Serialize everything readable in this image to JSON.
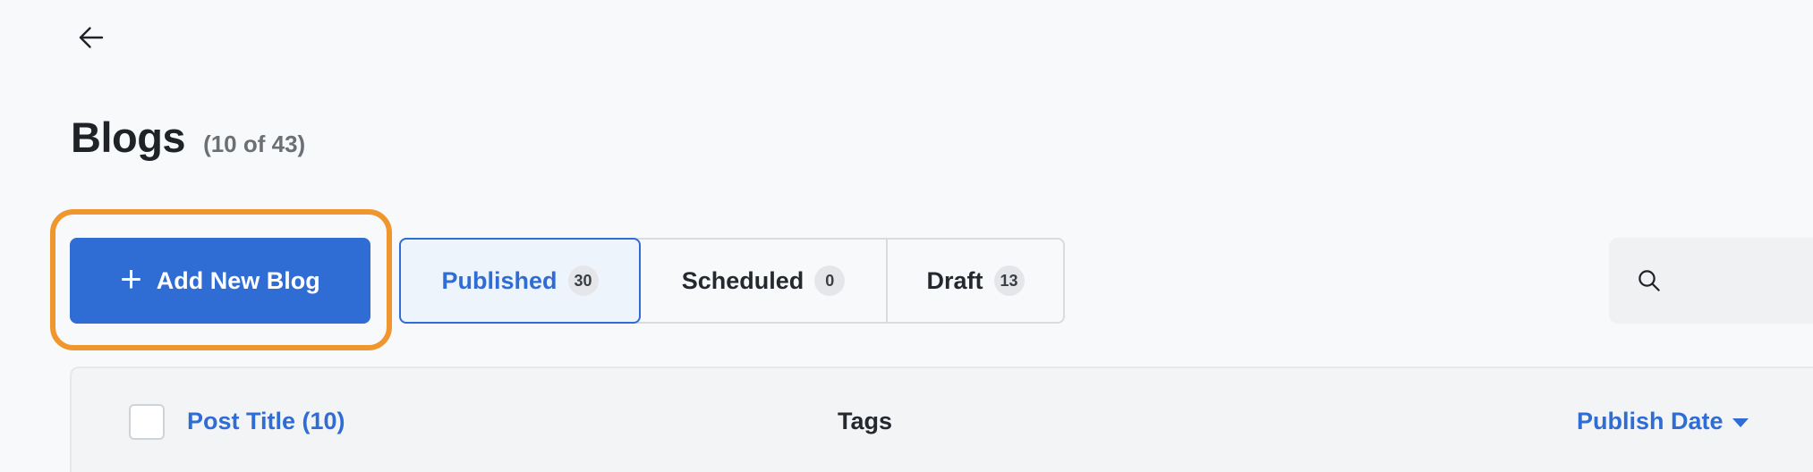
{
  "header": {
    "back_icon": "arrow-left-icon",
    "title": "Blogs",
    "count": "(10 of 43)"
  },
  "toolbar": {
    "add_button_label": "Add New Blog",
    "add_button_icon": "plus-icon",
    "highlight_color": "#f0962e",
    "accent_color": "#2f6cd4"
  },
  "tabs": [
    {
      "label": "Published",
      "count": "30",
      "selected": true
    },
    {
      "label": "Scheduled",
      "count": "0",
      "selected": false
    },
    {
      "label": "Draft",
      "count": "13",
      "selected": false
    }
  ],
  "search": {
    "icon": "search-icon",
    "placeholder": ""
  },
  "table": {
    "columns": [
      {
        "label": "Post Title (10)",
        "sortable": true
      },
      {
        "label": "Tags",
        "sortable": false
      },
      {
        "label": "Publish Date",
        "sortable": true,
        "sort_direction": "desc"
      }
    ]
  }
}
